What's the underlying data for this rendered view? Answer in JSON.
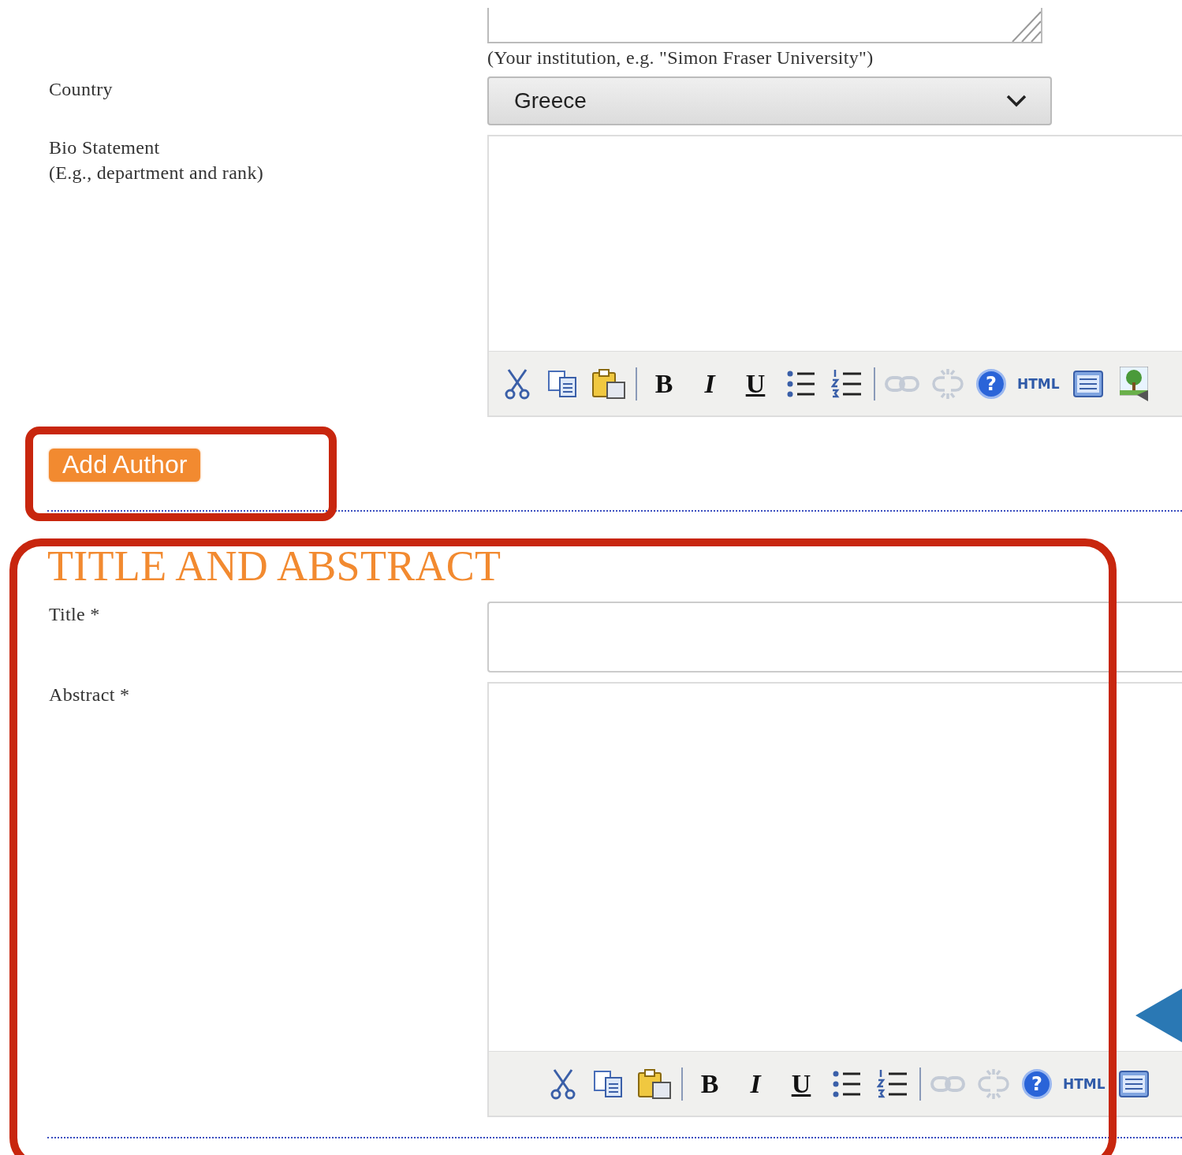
{
  "institution_field": {
    "hint": "(Your institution, e.g. \"Simon Fraser University\")"
  },
  "fields": [
    {
      "kind": "select",
      "label": "Country",
      "value": "Greece"
    },
    {
      "kind": "editor",
      "label": "Bio Statement",
      "sublabel": "(E.g., department and rank)",
      "toolbar": [
        {
          "kind": "cut",
          "disabled": false
        },
        {
          "kind": "copy",
          "disabled": false
        },
        {
          "kind": "paste",
          "disabled": false
        },
        {
          "kind": "separator"
        },
        {
          "kind": "bold",
          "label": "B",
          "disabled": false
        },
        {
          "kind": "italic",
          "label": "I",
          "disabled": false
        },
        {
          "kind": "underline",
          "label": "U",
          "disabled": false
        },
        {
          "kind": "bullets",
          "disabled": false
        },
        {
          "kind": "numbers",
          "disabled": false
        },
        {
          "kind": "separator"
        },
        {
          "kind": "link",
          "disabled": true
        },
        {
          "kind": "unlink",
          "disabled": true
        },
        {
          "kind": "help",
          "label": "?",
          "disabled": false
        },
        {
          "kind": "html",
          "label": "HTML",
          "disabled": false
        },
        {
          "kind": "block",
          "disabled": false
        },
        {
          "kind": "image",
          "disabled": false
        }
      ]
    }
  ],
  "add_author_button": "Add Author",
  "section": {
    "heading": "TITLE AND ABSTRACT",
    "fields": [
      {
        "kind": "input",
        "label": "Title *"
      },
      {
        "kind": "editor",
        "label": "Abstract *",
        "toolbar": [
          {
            "kind": "cut",
            "disabled": false
          },
          {
            "kind": "copy",
            "disabled": false
          },
          {
            "kind": "paste",
            "disabled": false
          },
          {
            "kind": "separator"
          },
          {
            "kind": "bold",
            "label": "B",
            "disabled": false
          },
          {
            "kind": "italic",
            "label": "I",
            "disabled": false
          },
          {
            "kind": "underline",
            "label": "U",
            "disabled": false
          },
          {
            "kind": "bullets",
            "disabled": false
          },
          {
            "kind": "numbers",
            "disabled": false
          },
          {
            "kind": "separator"
          },
          {
            "kind": "link",
            "disabled": true
          },
          {
            "kind": "unlink",
            "disabled": true
          },
          {
            "kind": "help",
            "label": "?",
            "disabled": false
          },
          {
            "kind": "html",
            "label": "HTML",
            "disabled": false
          },
          {
            "kind": "block",
            "disabled": false
          }
        ]
      }
    ]
  },
  "annotations": [
    {
      "kind": "box"
    },
    {
      "kind": "box"
    },
    {
      "kind": "arrow"
    }
  ]
}
